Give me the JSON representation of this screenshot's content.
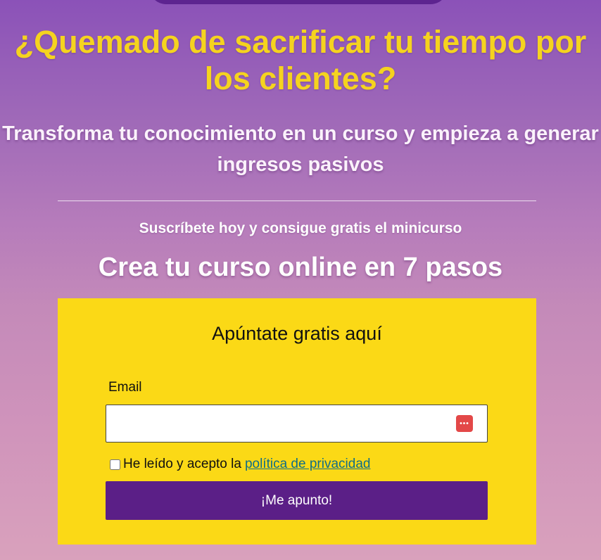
{
  "hero": {
    "headline": "¿Quemado de sacrificar tu tiempo por los clientes?",
    "subheadline": "Transforma tu conocimiento en un curso y empieza a generar ingresos pasivos",
    "subscribe_text": "Suscríbete hoy y consigue gratis el minicurso",
    "course_title": "Crea tu curso online en 7 pasos"
  },
  "form": {
    "title": "Apúntate gratis aquí",
    "email_label": "Email",
    "email_value": "",
    "password_manager_icon": "password-manager-icon",
    "consent_text": "He leído y acepto la",
    "consent_link": "política de privacidad",
    "submit_label": "¡Me apunto!"
  },
  "colors": {
    "headline": "#f5d31f",
    "form_background": "#fbd916",
    "button": "#5b1f87",
    "link": "#0f6e88",
    "background_top": "#8b52b8",
    "background_bottom": "#d9a1bc"
  }
}
